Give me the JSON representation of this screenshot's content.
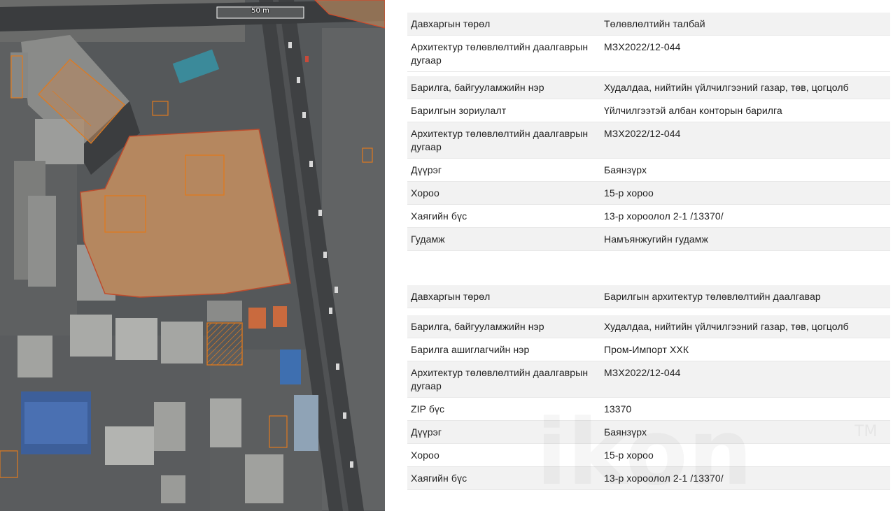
{
  "map": {
    "scale_label": "50 m"
  },
  "panel1": {
    "rows": [
      {
        "key": "Давхаргын төрөл",
        "value": "Төлөвлөлтийн талбай"
      },
      {
        "key": "Архитектур төлөвлөлтийн даалгаврын дугаар",
        "value": "МЗХ2022/12-044"
      },
      {
        "key": "Барилга, байгууламжийн нэр",
        "value": "Худалдаа, нийтийн үйлчилгээний газар, төв, цогцолб"
      },
      {
        "key": "Барилгын зориулалт",
        "value": "Үйлчилгээтэй албан конторын барилга"
      },
      {
        "key": "Архитектур төлөвлөлтийн даалгаврын дугаар",
        "value": "МЗХ2022/12-044"
      },
      {
        "key": "Дүүрэг",
        "value": "Баянзүрх"
      },
      {
        "key": "Хороо",
        "value": "15-р хороо"
      },
      {
        "key": "Хаягийн бүс",
        "value": "13-р хороолол 2-1 /13370/"
      },
      {
        "key": "Гудамж",
        "value": "Намъянжугийн гудамж"
      }
    ]
  },
  "panel2": {
    "rows": [
      {
        "key": "Давхаргын төрөл",
        "value": "Барилгын архитектур төлөвлөлтийн даалгавар"
      },
      {
        "key": "Барилга, байгууламжийн нэр",
        "value": "Худалдаа, нийтийн үйлчилгээний газар, төв, цогцолб"
      },
      {
        "key": "Барилга ашиглагчийн нэр",
        "value": "Пром-Импорт ХХК"
      },
      {
        "key": "Архитектур төлөвлөлтийн даалгаврын дугаар",
        "value": "МЗХ2022/12-044"
      },
      {
        "key": "ZIP бүс",
        "value": "13370"
      },
      {
        "key": "Дүүрэг",
        "value": "Баянзүрх"
      },
      {
        "key": "Хороо",
        "value": "15-р хороо"
      },
      {
        "key": "Хаягийн бүс",
        "value": "13-р хороолол 2-1 /13370/"
      }
    ]
  },
  "watermark": {
    "text": "ikon",
    "tm": "TM"
  },
  "colors": {
    "parcel_fill": "#b5875f",
    "parcel_stroke": "#d24a2a",
    "building_outline": "#e07a1e",
    "row_shade": "#f2f2f2",
    "text": "#222222"
  }
}
